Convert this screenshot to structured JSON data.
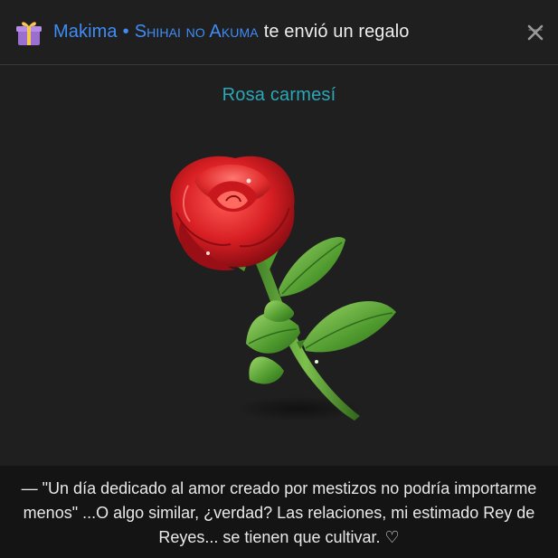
{
  "header": {
    "sender_name": "Makima",
    "separator": "•",
    "sender_title": "Shihai no Akuma",
    "message": "te envió un regalo",
    "gift_icon": "gift-box-icon",
    "close_icon": "close-icon"
  },
  "gift": {
    "name": "Rosa carmesí",
    "image": "red-rose-image"
  },
  "footer": {
    "text": "— \"Un día dedicado al amor creado por mestizos no podría importarme menos\" ...O algo similar, ¿verdad? Las relaciones, mi estimado Rey de Reyes... se tienen que cultivar. ♡"
  },
  "colors": {
    "background": "#1f1f20",
    "footer_background": "#141414",
    "link_blue": "#3f8cf6",
    "gift_teal": "#2aa7b8",
    "text": "#e9e9ea"
  }
}
